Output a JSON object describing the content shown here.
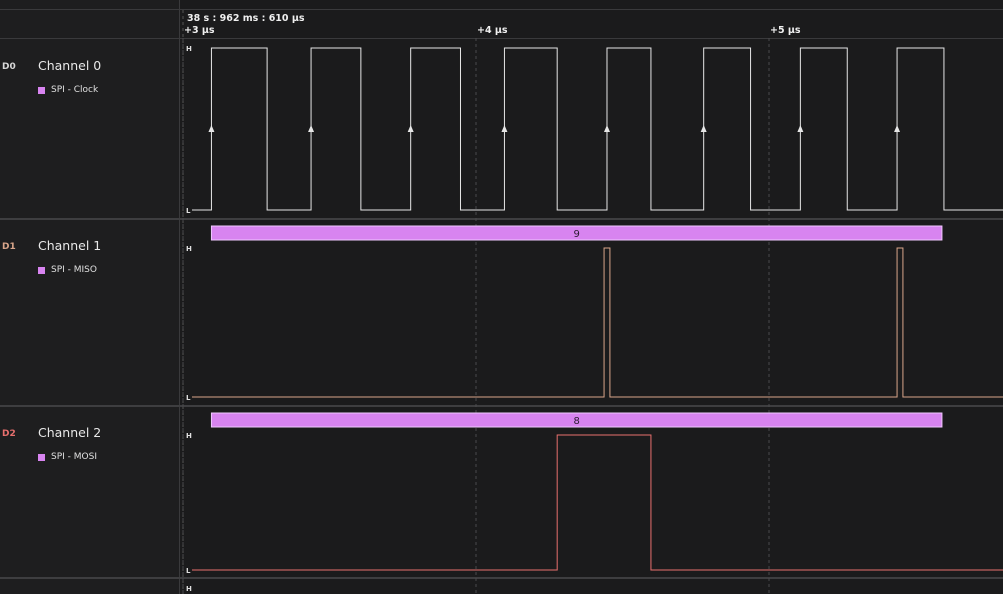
{
  "timebar": {
    "absolute_time": "38 s : 962 ms : 610 µs",
    "ticks": [
      {
        "label": "+3 µs",
        "us": 3
      },
      {
        "label": "+4 µs",
        "us": 4
      },
      {
        "label": "+5 µs",
        "us": 5
      }
    ]
  },
  "colors": {
    "clock": "#e6e6e6",
    "miso": "#d9a58a",
    "mosi": "#e8706e",
    "analyzer": "#d884f0",
    "d0_id": "#d8d8d8",
    "d1_id": "#d9a58a",
    "d2_id": "#e8706e"
  },
  "channels": [
    {
      "id": "D0",
      "name": "Channel 0",
      "analyzer": "SPI - Clock",
      "high_label": "H",
      "low_label": "L",
      "edges_us": [
        3.08,
        3.27,
        3.42,
        3.59,
        3.76,
        3.93,
        4.08,
        4.26,
        4.43,
        4.58,
        4.76,
        4.92,
        5.09,
        5.25,
        5.42,
        5.58
      ],
      "initial_level": 0,
      "rising_arrows": true
    },
    {
      "id": "D1",
      "name": "Channel 1",
      "analyzer": "SPI - MISO",
      "high_label": "H",
      "low_label": "L",
      "decoded_value": "9",
      "edges_us": [
        4.42,
        4.44,
        5.42,
        5.44
      ],
      "initial_level": 0,
      "rising_arrows": false
    },
    {
      "id": "D2",
      "name": "Channel 2",
      "analyzer": "SPI - MOSI",
      "high_label": "H",
      "low_label": "L",
      "decoded_value": "8",
      "edges_us": [
        4.26,
        4.58
      ],
      "initial_level": 0,
      "rising_arrows": false
    }
  ],
  "next_row_high_label": "H"
}
